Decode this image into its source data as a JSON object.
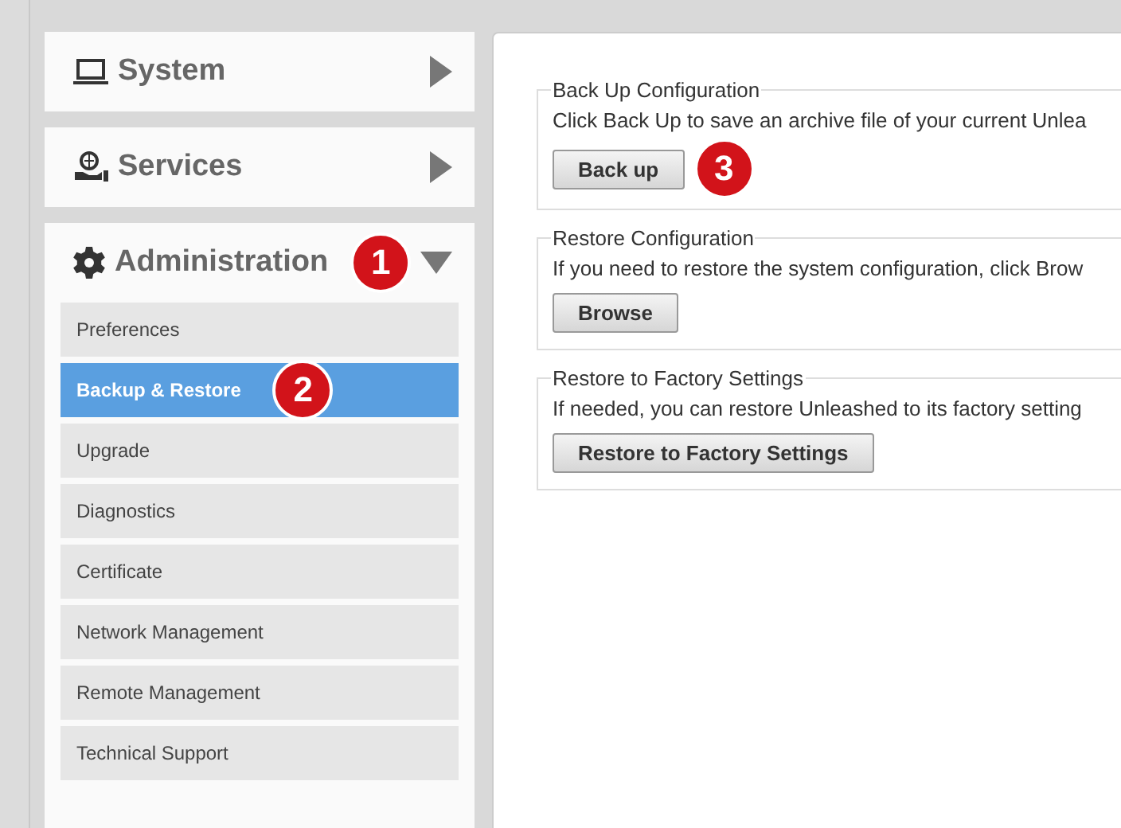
{
  "sidebar": {
    "sections": [
      {
        "label": "System",
        "expanded": false
      },
      {
        "label": "Services",
        "expanded": false
      },
      {
        "label": "Administration",
        "expanded": true,
        "callout": "1",
        "children": [
          {
            "label": "Preferences",
            "selected": false
          },
          {
            "label": "Backup & Restore",
            "selected": true,
            "callout": "2"
          },
          {
            "label": "Upgrade",
            "selected": false
          },
          {
            "label": "Diagnostics",
            "selected": false
          },
          {
            "label": "Certificate",
            "selected": false
          },
          {
            "label": "Network Management",
            "selected": false
          },
          {
            "label": "Remote Management",
            "selected": false
          },
          {
            "label": "Technical Support",
            "selected": false
          }
        ]
      }
    ]
  },
  "content": {
    "groups": [
      {
        "legend": "Back Up Configuration",
        "text": "Click Back Up to save an archive file of your current Unlea",
        "button": "Back up",
        "callout": "3"
      },
      {
        "legend": "Restore Configuration",
        "text": "If you need to restore the system configuration, click Brow",
        "button": "Browse"
      },
      {
        "legend": "Restore to Factory Settings",
        "text": "If needed, you can restore Unleashed to its factory setting",
        "button": "Restore to Factory Settings"
      }
    ]
  }
}
